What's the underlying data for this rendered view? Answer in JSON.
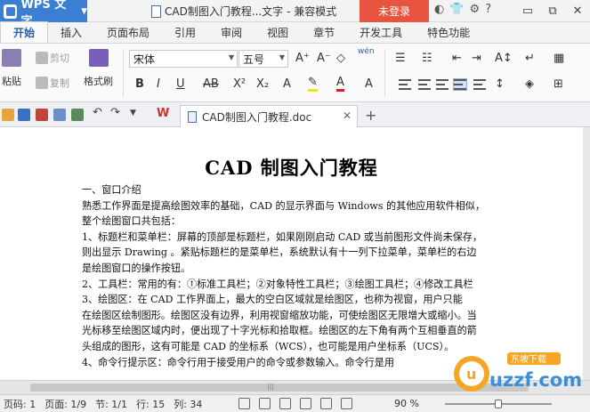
{
  "titlebar": {
    "app_menu": "WPS 文字",
    "doc_title": "CAD制图入门教程...文字 - 兼容模式",
    "login": "未登录"
  },
  "menu": {
    "tabs": [
      "开始",
      "插入",
      "页面布局",
      "引用",
      "审阅",
      "视图",
      "章节",
      "开发工具",
      "特色功能"
    ]
  },
  "ribbon": {
    "paste": "粘贴",
    "cut": "剪切",
    "copy": "复制",
    "format_painter": "格式刷",
    "font_name": "宋体",
    "font_size": "五号",
    "pinyin": "wén"
  },
  "doc_tab": {
    "name": "CAD制图入门教程.doc"
  },
  "document": {
    "title": "CAD 制图入门教程",
    "lines": [
      "一、窗口介绍",
      "熟悉工作界面是提高绘图效率的基础，CAD 的显示界面与 Windows 的其他应用软件相似，",
      "整个绘图窗口共包括：",
      "1、标题栏和菜单栏：屏幕的顶部是标题栏，如果刚刚启动 CAD 或当前图形文件尚未保存，",
      "则出显示 Drawing 。紧贴标题栏的是菜单栏，系统默认有十一列下拉菜单，菜单栏的右边",
      "是绘图窗口的操作按钮。",
      "2、工具栏：常用的有：①标准工具栏；②对象特性工具栏；③绘图工具栏；④修改工具栏",
      "3、绘图区：在 CAD 工作界面上，最大的空白区域就是绘图区，也称为视窗，用户只能",
      "在绘图区绘制图形。绘图区没有边界，利用视窗缩放功能，可使绘图区无限增大或缩小。当",
      "光标移至绘图区域内时，便出现了十字光标和拾取框。绘图区的左下角有两个互相垂直的箭",
      "头组成的图形，这有可能是 CAD 的坐标系（WCS），也可能是用户坐标系（UCS）。",
      "4、命令行提示区：命令行用于接受用户的命令或参数输入。命令行是用"
    ]
  },
  "status": {
    "page_code": "页码: 1",
    "page": "页面: 1/9",
    "section": "节: 1/1",
    "row": "行: 15",
    "col": "列: 34",
    "zoom": "90 %"
  },
  "watermark": {
    "top": "东坡下载",
    "main": "uzzf.com"
  }
}
